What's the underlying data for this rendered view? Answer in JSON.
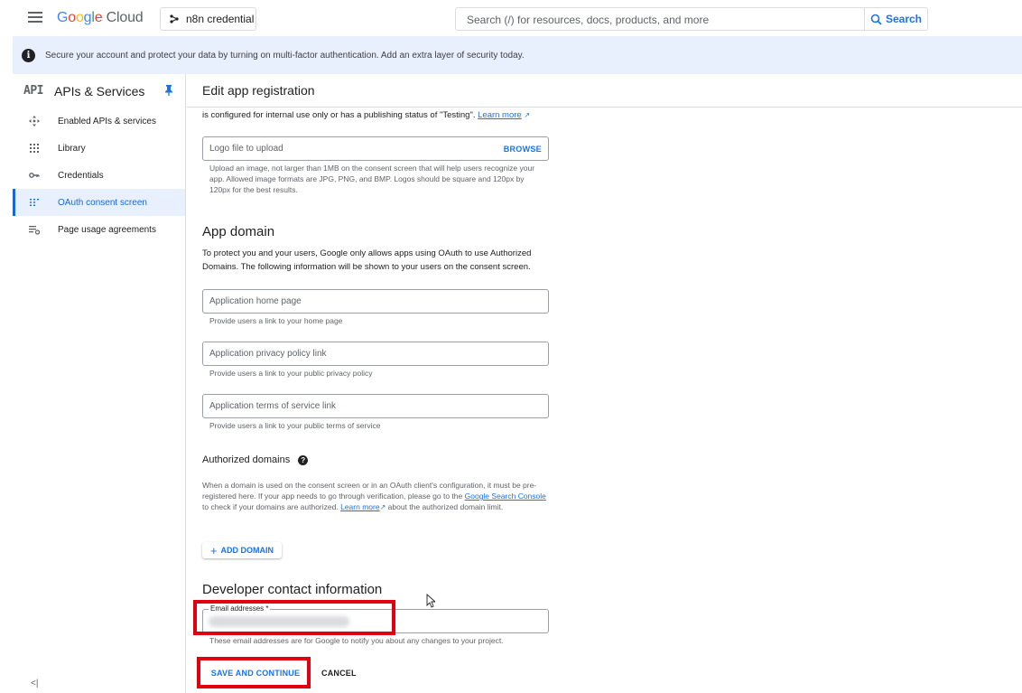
{
  "topbar": {
    "logo_letters": [
      "G",
      "o",
      "o",
      "g",
      "l",
      "e"
    ],
    "logo_cloud": "Cloud",
    "project_name": "n8n credential",
    "search_placeholder": "Search (/) for resources, docs, products, and more",
    "search_button": "Search"
  },
  "banner": {
    "text": "Secure your account and protect your data by turning on multi-factor authentication. Add an extra layer of security today."
  },
  "sidebar": {
    "api_mark": "API",
    "title": "APIs & Services",
    "items": [
      {
        "label": "Enabled APIs & services",
        "icon": "move-icon",
        "active": false
      },
      {
        "label": "Library",
        "icon": "library-icon",
        "active": false
      },
      {
        "label": "Credentials",
        "icon": "key-icon",
        "active": false
      },
      {
        "label": "OAuth consent screen",
        "icon": "consent-icon",
        "active": true
      },
      {
        "label": "Page usage agreements",
        "icon": "settings-list-icon",
        "active": false
      }
    ],
    "collapse_label": "<|"
  },
  "page": {
    "title": "Edit app registration",
    "intro_text": "is configured for internal use only or has a publishing status of \"Testing\".",
    "intro_link": "Learn more",
    "logo_field": {
      "placeholder": "Logo file to upload",
      "button": "BROWSE"
    },
    "logo_hint": "Upload an image, not larger than 1MB on the consent screen that will help users recognize your app. Allowed image formats are JPG, PNG, and BMP. Logos should be square and 120px by 120px for the best results.",
    "app_domain": {
      "heading": "App domain",
      "description": "To protect you and your users, Google only allows apps using OAuth to use Authorized Domains. The following information will be shown to your users on the consent screen.",
      "fields": [
        {
          "placeholder": "Application home page",
          "hint": "Provide users a link to your home page"
        },
        {
          "placeholder": "Application privacy policy link",
          "hint": "Provide users a link to your public privacy policy"
        },
        {
          "placeholder": "Application terms of service link",
          "hint": "Provide users a link to your public terms of service"
        }
      ]
    },
    "authorized_domains": {
      "heading": "Authorized domains",
      "text_1": "When a domain is used on the consent screen or in an OAuth client's configuration, it must be pre-registered here. If your app needs to go through verification, please go to the",
      "link_1": "Google Search Console",
      "text_2": "to check if your domains are authorized.",
      "link_2": "Learn more",
      "text_3": "about the authorized domain limit.",
      "add_button": "ADD DOMAIN"
    },
    "developer_contact": {
      "heading": "Developer contact information",
      "email_label": "Email addresses *",
      "email_value": "",
      "hint": "These email addresses are for Google to notify you about any changes to your project."
    },
    "save_button": "SAVE AND CONTINUE",
    "cancel_button": "CANCEL"
  },
  "colors": {
    "accent": "#1a73e8",
    "highlight_box": "#e0000f",
    "banner_bg": "#e8f0fe"
  }
}
